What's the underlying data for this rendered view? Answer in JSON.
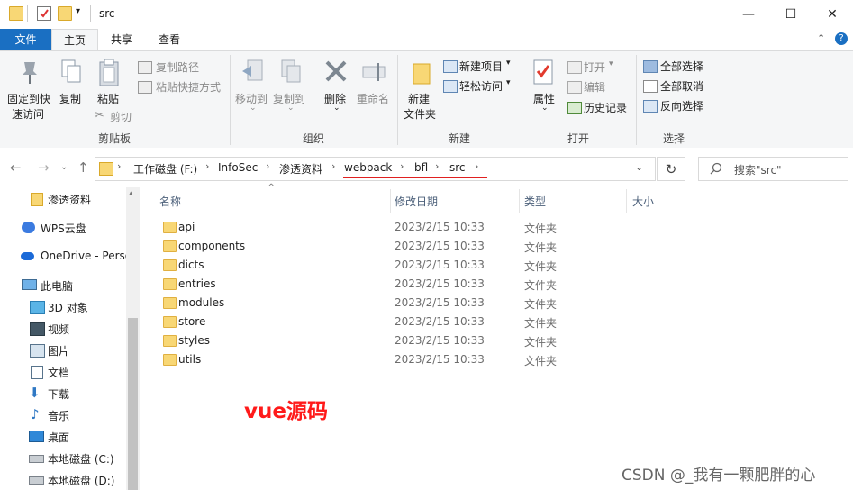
{
  "window": {
    "title": "src"
  },
  "tabs": {
    "file": "文件",
    "home": "主页",
    "share": "共享",
    "view": "查看"
  },
  "ribbon": {
    "clipboard": {
      "pin": "固定到快速访问",
      "pin_line1": "固定到快",
      "pin_line2": "速访问",
      "copy": "复制",
      "paste": "粘贴",
      "copy_path": "复制路径",
      "paste_shortcut": "粘贴快捷方式",
      "cut": "剪切",
      "label": "剪贴板"
    },
    "organize": {
      "move_to": "移动到",
      "copy_to": "复制到",
      "delete": "删除",
      "rename": "重命名",
      "label": "组织"
    },
    "new": {
      "new_folder_line1": "新建",
      "new_folder_line2": "文件夹",
      "new_item": "新建项目",
      "easy_access": "轻松访问",
      "label": "新建"
    },
    "open": {
      "properties": "属性",
      "open": "打开",
      "edit": "编辑",
      "history": "历史记录",
      "label": "打开"
    },
    "select": {
      "select_all": "全部选择",
      "select_none": "全部取消",
      "invert": "反向选择",
      "label": "选择"
    }
  },
  "address": {
    "crumbs": [
      "工作磁盘 (F:)",
      "InfoSec",
      "渗透资料",
      "webpack",
      "bfl",
      "src"
    ],
    "search_placeholder": "搜索\"src\""
  },
  "nav_pane": {
    "items": [
      {
        "label": "渗透资料",
        "icon": "folder-icon"
      },
      {
        "label": "WPS云盘",
        "icon": "cloud-icon"
      },
      {
        "label": "OneDrive - Perso",
        "icon": "onedrive-icon"
      },
      {
        "label": "此电脑",
        "icon": "computer-icon"
      },
      {
        "label": "3D 对象",
        "icon": "3d-objects-icon"
      },
      {
        "label": "视频",
        "icon": "video-icon"
      },
      {
        "label": "图片",
        "icon": "pictures-icon"
      },
      {
        "label": "文档",
        "icon": "documents-icon"
      },
      {
        "label": "下载",
        "icon": "download-icon"
      },
      {
        "label": "音乐",
        "icon": "music-icon"
      },
      {
        "label": "桌面",
        "icon": "desktop-icon"
      },
      {
        "label": "本地磁盘 (C:)",
        "icon": "drive-icon"
      },
      {
        "label": "本地磁盘 (D:)",
        "icon": "drive-icon"
      }
    ]
  },
  "file_list": {
    "columns": {
      "name": "名称",
      "date": "修改日期",
      "type": "类型",
      "size": "大小"
    },
    "rows": [
      {
        "name": "api",
        "date": "2023/2/15 10:33",
        "type": "文件夹"
      },
      {
        "name": "components",
        "date": "2023/2/15 10:33",
        "type": "文件夹"
      },
      {
        "name": "dicts",
        "date": "2023/2/15 10:33",
        "type": "文件夹"
      },
      {
        "name": "entries",
        "date": "2023/2/15 10:33",
        "type": "文件夹"
      },
      {
        "name": "modules",
        "date": "2023/2/15 10:33",
        "type": "文件夹"
      },
      {
        "name": "store",
        "date": "2023/2/15 10:33",
        "type": "文件夹"
      },
      {
        "name": "styles",
        "date": "2023/2/15 10:33",
        "type": "文件夹"
      },
      {
        "name": "utils",
        "date": "2023/2/15 10:33",
        "type": "文件夹"
      }
    ]
  },
  "annotation": {
    "text": "vue源码",
    "color": "#ff1a1a"
  },
  "watermark": "CSDN @_我有一颗肥胖的心",
  "colors": {
    "file_tab": "#1a6fc2",
    "ribbon_bg": "#f5f6f7",
    "folder": "#f8d775",
    "underline": "#e02020"
  }
}
